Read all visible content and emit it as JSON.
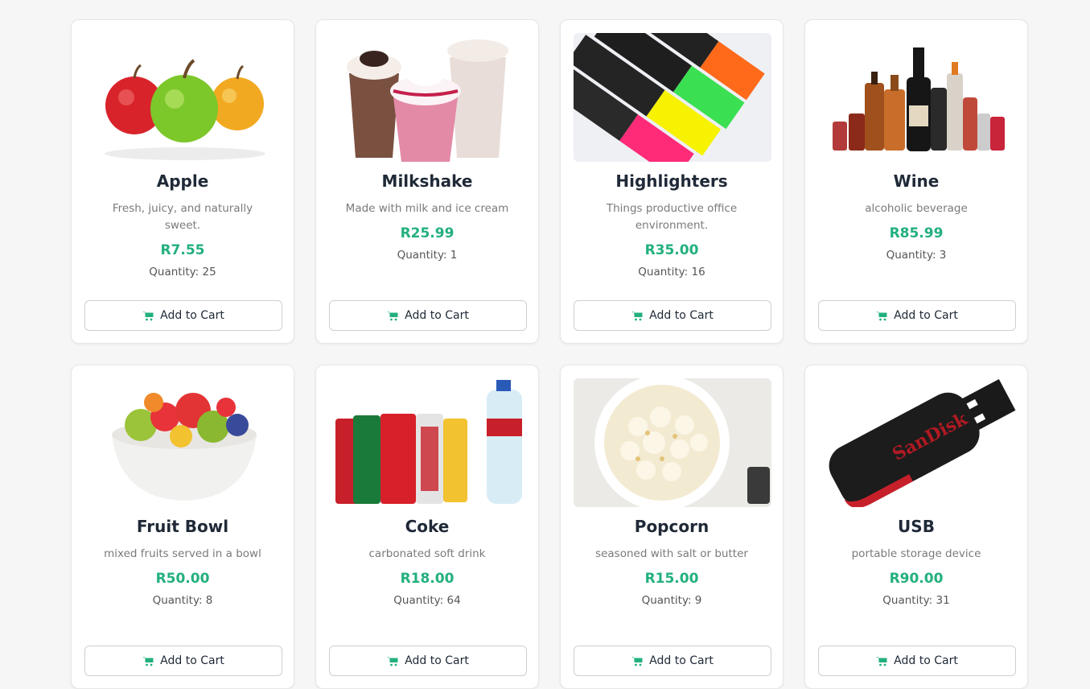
{
  "accent_color": "#22b07d",
  "cart_icon": "shopping-cart-icon",
  "products": [
    {
      "name": "Apple",
      "description": "Fresh, juicy, and naturally sweet.",
      "price": "R7.55",
      "quantity_label": "Quantity:",
      "quantity": "25",
      "button_label": "Add to Cart",
      "image": "apple-image"
    },
    {
      "name": "Milkshake",
      "description": "Made with milk and ice cream",
      "price": "R25.99",
      "quantity_label": "Quantity:",
      "quantity": "1",
      "button_label": "Add to Cart",
      "image": "milkshake-image"
    },
    {
      "name": "Highlighters",
      "description": "Things productive office environment.",
      "price": "R35.00",
      "quantity_label": "Quantity:",
      "quantity": "16",
      "button_label": "Add to Cart",
      "image": "highlighters-image"
    },
    {
      "name": "Wine",
      "description": "alcoholic beverage",
      "price": "R85.99",
      "quantity_label": "Quantity:",
      "quantity": "3",
      "button_label": "Add to Cart",
      "image": "wine-bottles-image"
    },
    {
      "name": "Fruit Bowl",
      "description": "mixed fruits served in a bowl",
      "price": "R50.00",
      "quantity_label": "Quantity:",
      "quantity": "8",
      "button_label": "Add to Cart",
      "image": "fruit-bowl-image"
    },
    {
      "name": "Coke",
      "description": "carbonated soft drink",
      "price": "R18.00",
      "quantity_label": "Quantity:",
      "quantity": "64",
      "button_label": "Add to Cart",
      "image": "soda-cans-image"
    },
    {
      "name": "Popcorn",
      "description": "seasoned with salt or butter",
      "price": "R15.00",
      "quantity_label": "Quantity:",
      "quantity": "9",
      "button_label": "Add to Cart",
      "image": "popcorn-image"
    },
    {
      "name": "USB",
      "description": "portable storage device",
      "price": "R90.00",
      "quantity_label": "Quantity:",
      "quantity": "31",
      "button_label": "Add to Cart",
      "image": "usb-drive-image"
    }
  ],
  "image_labels": {
    "usb_brand": "SanDisk"
  }
}
